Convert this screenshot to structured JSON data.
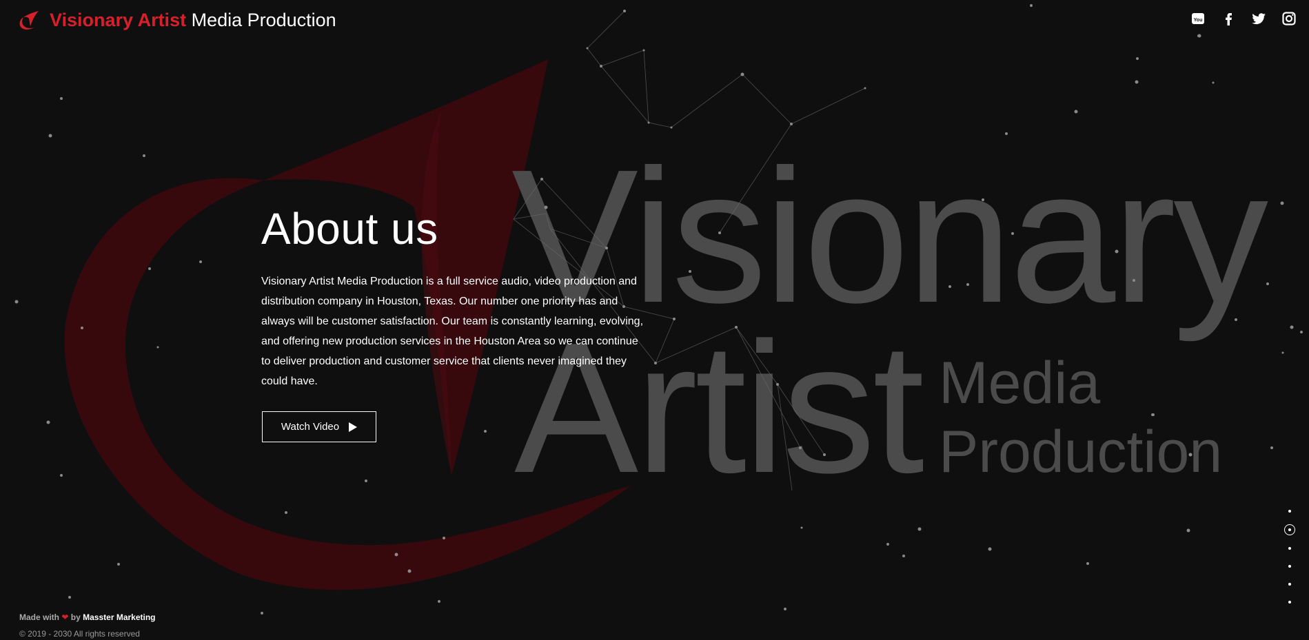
{
  "header": {
    "title_accent": "Visionary Artist",
    "title_rest": " Media Production",
    "logo_icon": "va-swoosh-logo"
  },
  "social": [
    {
      "name": "youtube",
      "icon": "youtube-icon"
    },
    {
      "name": "facebook",
      "icon": "facebook-icon"
    },
    {
      "name": "twitter",
      "icon": "twitter-icon"
    },
    {
      "name": "instagram",
      "icon": "instagram-icon"
    }
  ],
  "main": {
    "title": "About us",
    "description": "Visionary Artist Media Production is a full service audio, video production and distribution company in Houston, Texas. Our number one priority has and always will be customer satisfaction. Our team is constantly learning, evolving, and offering new production services in the Houston Area so we can continue to deliver production and customer service that clients never imagined they could have.",
    "button_label": "Watch Video"
  },
  "watermark": {
    "line1": "Visionary",
    "line2": "Artist",
    "line3": "Media",
    "line4": "Production"
  },
  "pagination": {
    "count": 6,
    "active_index": 1
  },
  "footer": {
    "made_prefix": "Made with",
    "made_by": "by",
    "brand": "Masster Marketing",
    "copyright": "© 2019 - 2030 All rights reserved"
  },
  "colors": {
    "accent": "#d8202b",
    "background": "#0f0f0f",
    "watermark": "#4a4a4a",
    "logo_dark_red": "#3d0b0f"
  }
}
